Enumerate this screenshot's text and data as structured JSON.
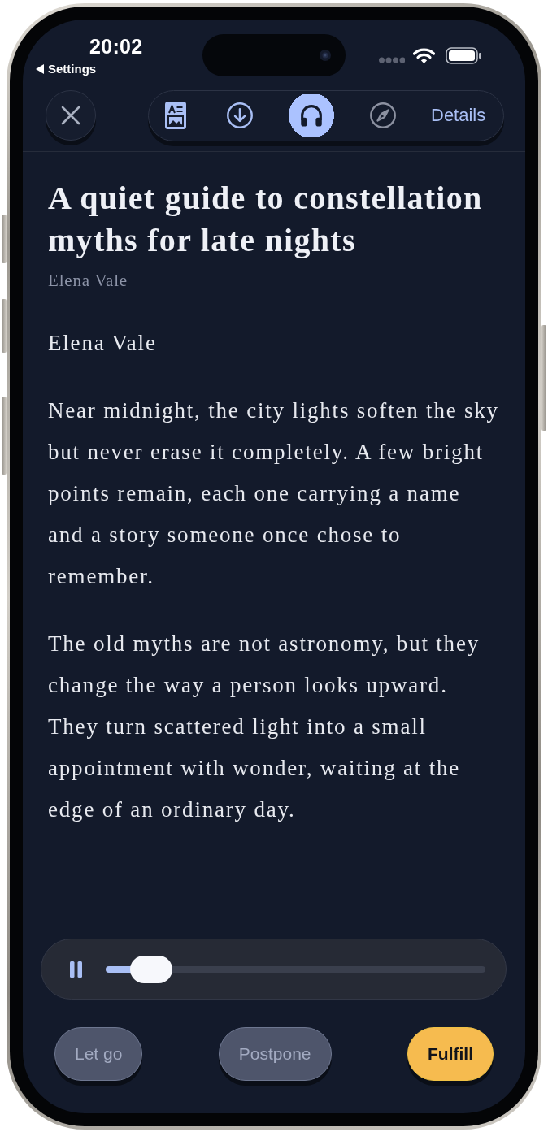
{
  "status_bar": {
    "time": "20:02",
    "back_label": "Settings"
  },
  "toolbar": {
    "tabs": [
      {
        "selected": false,
        "disabled": false
      },
      {
        "selected": false,
        "disabled": false
      },
      {
        "selected": true,
        "disabled": false
      },
      {
        "selected": false,
        "disabled": true
      },
      {
        "label": "Details",
        "selected": false,
        "disabled": false
      }
    ]
  },
  "article": {
    "title": "A quiet guide to constellation myths for late nights",
    "byline": "Elena Vale",
    "paragraphs": [
      "Elena Vale",
      "Near midnight, the city lights soften the sky but never erase it completely. A few bright points remain, each one carrying a name and a story someone once chose to remember.",
      "The old myths are not astronomy, but they change the way a person looks upward. They turn scattered light into a small appointment with wonder, waiting at the edge of an ordinary day."
    ]
  },
  "player": {
    "playing": true,
    "level": 0.12
  },
  "actions": [
    {
      "label": "Let go",
      "kind": "secondary"
    },
    {
      "label": "Postpone",
      "kind": "secondary"
    },
    {
      "label": "Fulfill",
      "kind": "primary"
    }
  ]
}
